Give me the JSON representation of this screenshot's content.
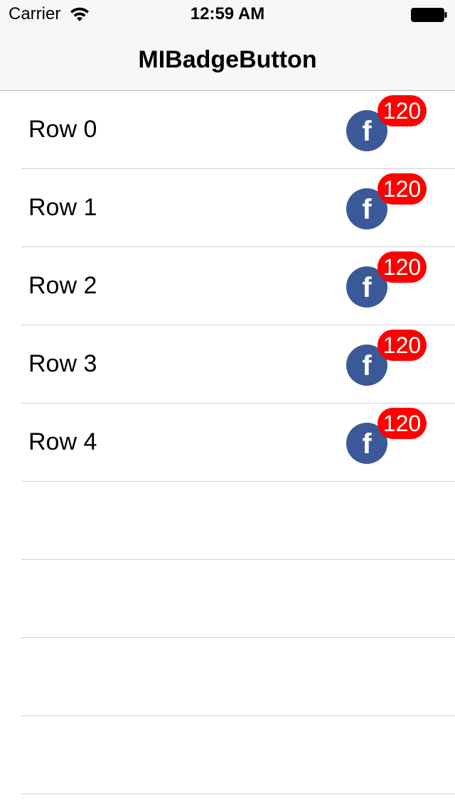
{
  "status_bar": {
    "carrier": "Carrier",
    "time": "12:59 AM",
    "wifi_icon": "wifi-icon",
    "battery_icon": "battery-icon"
  },
  "nav": {
    "title": "MIBadgeButton"
  },
  "rows": [
    {
      "label": "Row 0",
      "button_glyph": "f",
      "badge": "120"
    },
    {
      "label": "Row 1",
      "button_glyph": "f",
      "badge": "120"
    },
    {
      "label": "Row 2",
      "button_glyph": "f",
      "badge": "120"
    },
    {
      "label": "Row 3",
      "button_glyph": "f",
      "badge": "120"
    },
    {
      "label": "Row 4",
      "button_glyph": "f",
      "badge": "120"
    }
  ],
  "colors": {
    "facebook_blue": "#3b5998",
    "badge_red": "#fe0000",
    "navbar_bg": "#f7f7f7",
    "separator": "#cfcfd4"
  }
}
